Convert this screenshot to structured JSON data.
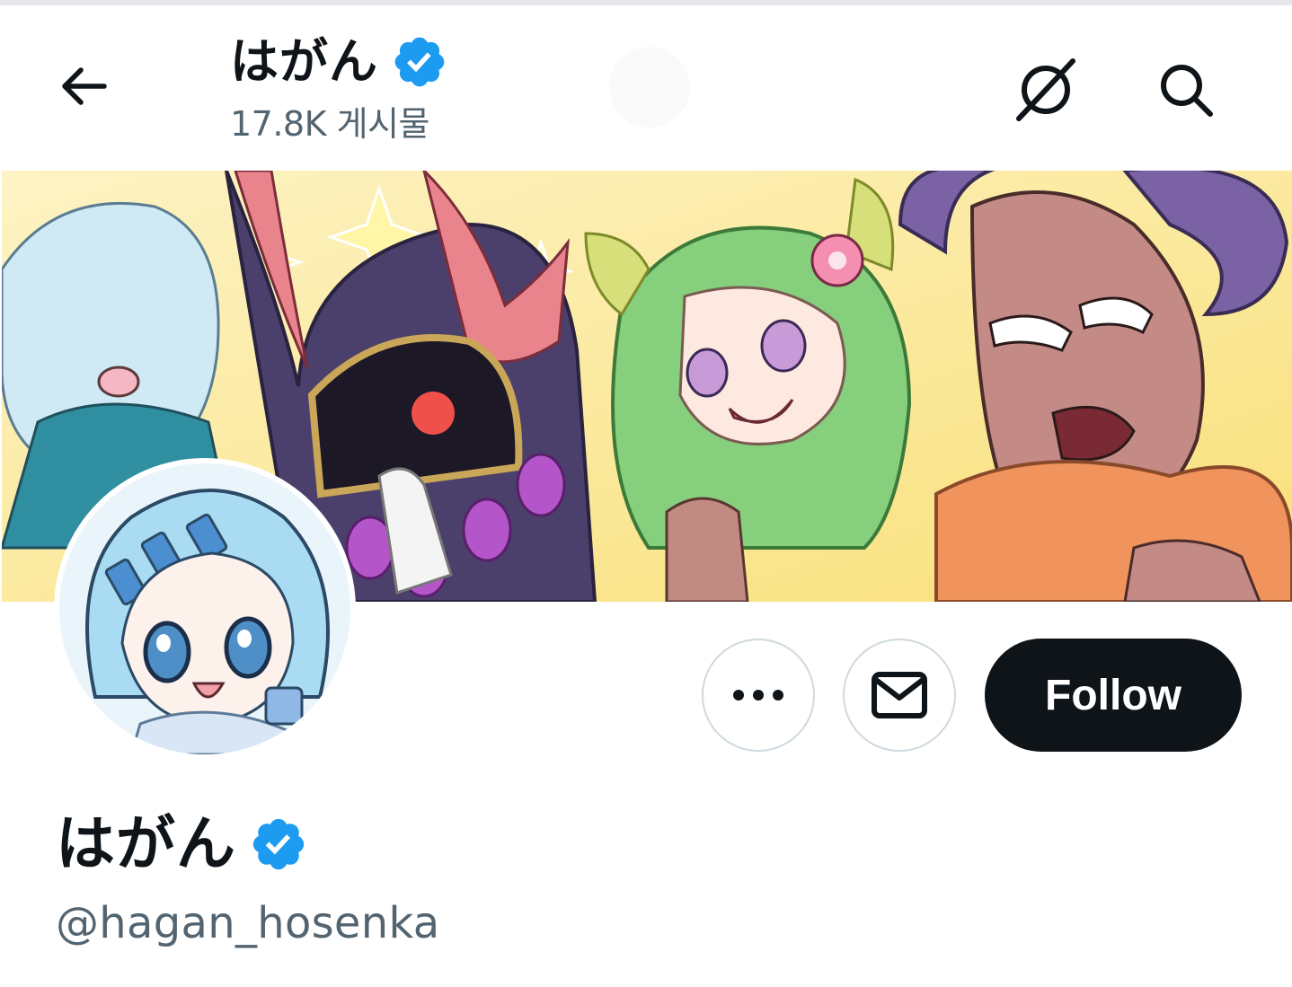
{
  "header": {
    "display_name": "はがん",
    "posts_count": "17.8K 게시물",
    "back_icon": "arrow-left-icon",
    "grok_icon": "grok-icon",
    "search_icon": "search-icon"
  },
  "profile": {
    "display_name": "はがん",
    "handle": "@hagan_hosenka",
    "verified_icon": "verified-badge-icon",
    "verified_color": "#1d9bf0"
  },
  "actions": {
    "more_icon": "more-dots-icon",
    "message_icon": "envelope-icon",
    "follow_label": "Follow"
  },
  "banner": {
    "image_icon": "banner-illustration"
  },
  "avatar": {
    "image_icon": "avatar-illustration"
  },
  "colors": {
    "text_primary": "#0f1419",
    "text_secondary": "#536471",
    "border": "#cfd9de",
    "follow_bg": "#0f1419"
  }
}
